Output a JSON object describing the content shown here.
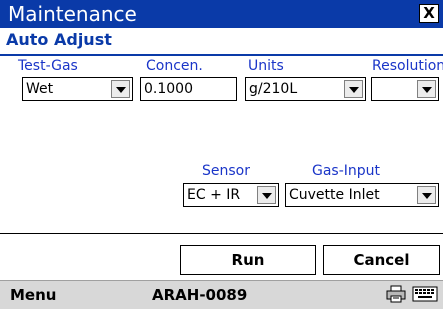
{
  "window": {
    "title": "Maintenance",
    "close_glyph": "X"
  },
  "section": {
    "title": "Auto Adjust"
  },
  "fields": {
    "test_gas": {
      "label": "Test-Gas",
      "value": "Wet"
    },
    "concentration": {
      "label": "Concen.",
      "value": "0.1000"
    },
    "units": {
      "label": "Units",
      "value": "g/210L"
    },
    "resolution": {
      "label": "Resolution",
      "value": ""
    },
    "sensor": {
      "label": "Sensor",
      "value": "EC + IR"
    },
    "gas_input": {
      "label": "Gas-Input",
      "value": "Cuvette Inlet"
    }
  },
  "buttons": {
    "run": "Run",
    "cancel": "Cancel"
  },
  "menubar": {
    "menu": "Menu",
    "device_id": "ARAH-0089",
    "icons": [
      "printer-icon",
      "keyboard-icon"
    ]
  },
  "colors": {
    "title_bar": "#0a3aa8",
    "label_text": "#1a35c8",
    "menubar": "#d8d8d8"
  }
}
